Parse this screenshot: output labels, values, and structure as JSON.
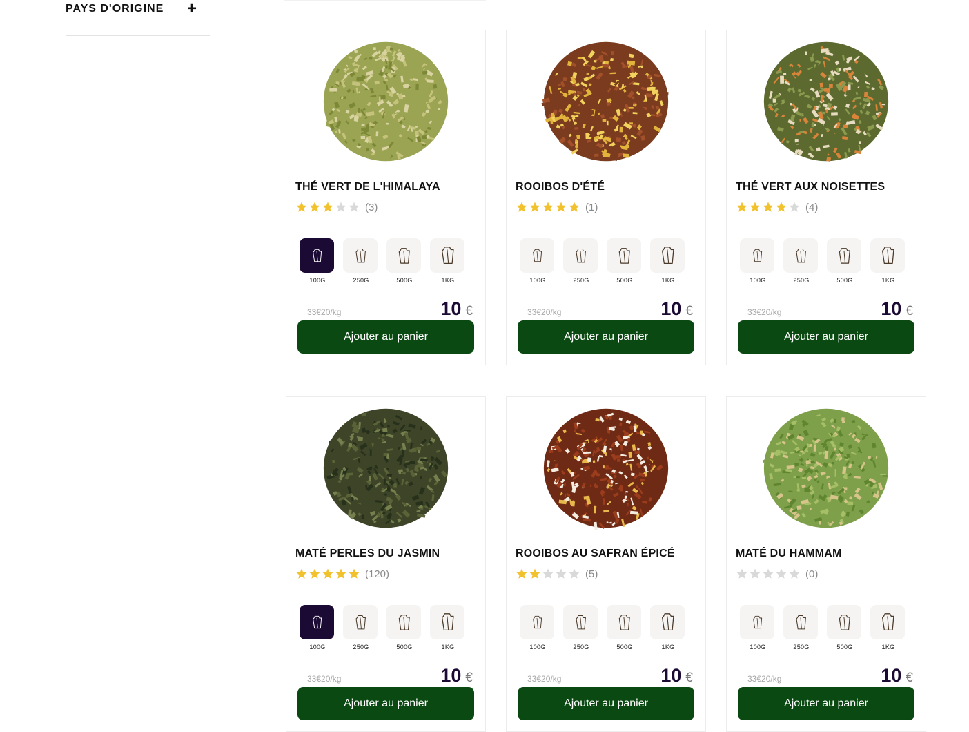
{
  "filter": {
    "title": "PAYS D'ORIGINE",
    "toggle": "+"
  },
  "colors": {
    "accent_dark": "#1b0a33",
    "button_green": "#0a4a12",
    "star_on": "#f2c12e",
    "star_off": "#d9d9d9"
  },
  "products": [
    {
      "name": "THÉ VERT DE L'HIMALAYA",
      "rating": 3,
      "reviews": "(3)",
      "tea_colors": [
        "#9aa453",
        "#c5c27c",
        "#7c8836",
        "#d8d3a0"
      ],
      "sizes": [
        "100G",
        "250G",
        "500G",
        "1KG"
      ],
      "selected": 0,
      "unit_price": "33€20/kg",
      "price": "10",
      "currency": "€",
      "button": "Ajouter au panier"
    },
    {
      "name": "ROOIBOS D'ÉTÉ",
      "rating": 5,
      "reviews": "(1)",
      "tea_colors": [
        "#7a3b1f",
        "#a2502a",
        "#e2b43c",
        "#f0d25c"
      ],
      "sizes": [
        "100G",
        "250G",
        "500G",
        "1KG"
      ],
      "selected": -1,
      "unit_price": "33€20/kg",
      "price": "10",
      "currency": "€",
      "button": "Ajouter au panier"
    },
    {
      "name": "THÉ VERT AUX NOISETTES",
      "rating": 4,
      "reviews": "(4)",
      "tea_colors": [
        "#5c6a30",
        "#8b9a4e",
        "#d8843a",
        "#e8dcc0"
      ],
      "sizes": [
        "100G",
        "250G",
        "500G",
        "1KG"
      ],
      "selected": -1,
      "unit_price": "33€20/kg",
      "price": "10",
      "currency": "€",
      "button": "Ajouter au panier"
    },
    {
      "name": "MATÉ PERLES DU JASMIN",
      "rating": 5,
      "reviews": "(120)",
      "tea_colors": [
        "#3d4428",
        "#5a6338",
        "#27301a",
        "#76804f"
      ],
      "sizes": [
        "100G",
        "250G",
        "500G",
        "1KG"
      ],
      "selected": 0,
      "unit_price": "33€20/kg",
      "price": "10",
      "currency": "€",
      "button": "Ajouter au panier"
    },
    {
      "name": "ROOIBOS AU SAFRAN ÉPICÉ",
      "rating": 2,
      "reviews": "(5)",
      "tea_colors": [
        "#6e2a14",
        "#9b3d1d",
        "#e8b84a",
        "#f3ece0"
      ],
      "sizes": [
        "100G",
        "250G",
        "500G",
        "1KG"
      ],
      "selected": -1,
      "unit_price": "33€20/kg",
      "price": "10",
      "currency": "€",
      "button": "Ajouter au panier"
    },
    {
      "name": "MATÉ DU HAMMAM",
      "rating": 0,
      "reviews": "(0)",
      "tea_colors": [
        "#7ea04a",
        "#a6be66",
        "#d6c48a",
        "#5f8530"
      ],
      "sizes": [
        "100G",
        "250G",
        "500G",
        "1KG"
      ],
      "selected": -1,
      "unit_price": "33€20/kg",
      "price": "10",
      "currency": "€",
      "button": "Ajouter au panier"
    }
  ]
}
